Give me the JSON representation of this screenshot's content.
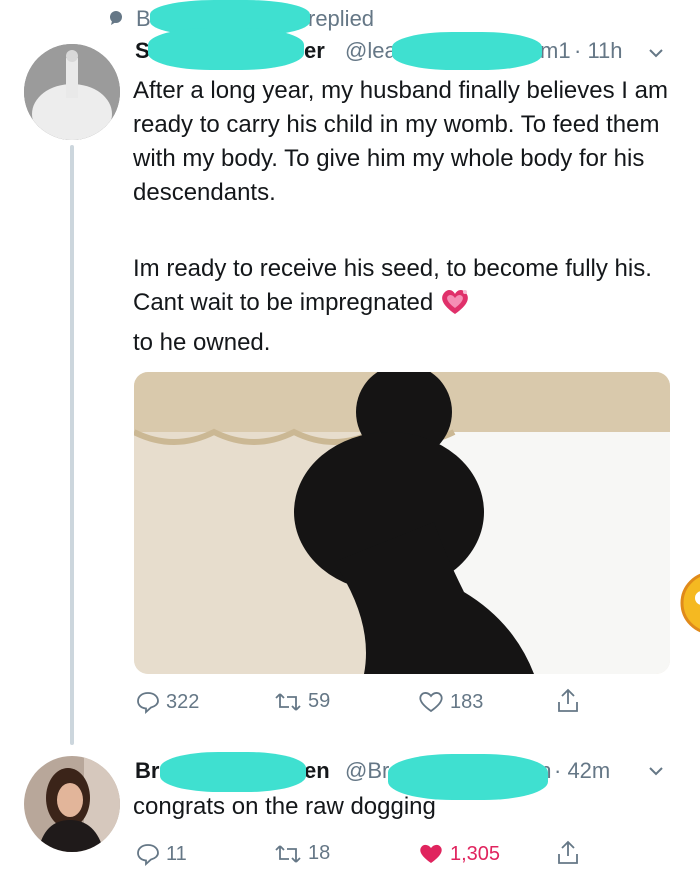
{
  "header": {
    "context_initial": "B",
    "context_suffix": "replied"
  },
  "tweet1": {
    "name_start": "S",
    "name_end": "er",
    "handle_start": "@lea",
    "handle_end": "m1",
    "time": "· 11h",
    "body_p1": "After a long year, my husband finally believes I am ready to carry his child in my womb. To feed them with my body. To give him my whole body for his descendants.",
    "body_p2_a": "Im ready to receive his seed, to become fully his. Cant wait to be impregnated",
    "body_p2_b": "to he owned.",
    "emoji": "sparkling-heart",
    "replies": "322",
    "retweets": "59",
    "likes": "183"
  },
  "tweet2": {
    "name_start": "Br",
    "name_end": "en",
    "handle_start": "@Bra",
    "handle_end": "sen",
    "time": "· 42m",
    "body": "congrats on the raw dogging",
    "replies": "11",
    "retweets": "18",
    "likes": "1,305",
    "like_color": "#e0245e"
  }
}
